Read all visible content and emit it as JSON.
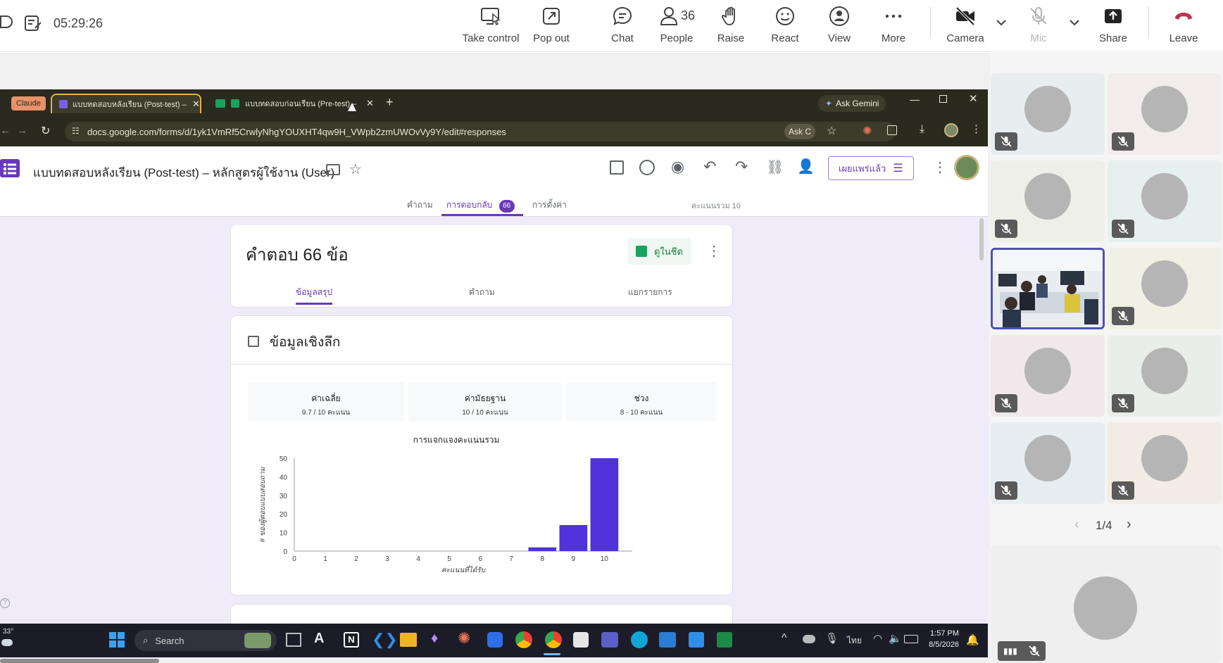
{
  "teams": {
    "timer": "05:29:26",
    "buttons": {
      "take_control": "Take control",
      "pop_out": "Pop out",
      "chat": "Chat",
      "people": "People",
      "people_count": "36",
      "raise": "Raise",
      "react": "React",
      "view": "View",
      "more": "More",
      "camera": "Camera",
      "mic": "Mic",
      "share": "Share",
      "leave": "Leave"
    },
    "pager": "1/4",
    "colors": {
      "leave": "#c4314b",
      "selected_tile": "#4f52b2"
    }
  },
  "chrome": {
    "profile_badge": "Claude",
    "tabs": [
      {
        "title": "แบบทดสอบหลังเรียน (Post-test) – ห"
      },
      {
        "title": "แบบทดสอบก่อนเรียน (Pre-test) – ห"
      }
    ],
    "ask_gemini": "Ask Gemini",
    "url": "docs.google.com/forms/d/1yk1VmRf5CrwlyNhgYOUXHT4qw9H_VWpb2zmUWOvVy9Y/edit#responses",
    "ask_chip": "Ask C"
  },
  "form": {
    "title": "แบบทดสอบหลังเรียน (Post-test) – หลักสูตรผู้ใช้งาน (User)",
    "tabs": {
      "questions": "คำถาม",
      "responses": "การตอบกลับ",
      "responses_count": "66",
      "settings": "การตั้งค่า"
    },
    "total_points": "คะแนนรวม 10",
    "publish_button": "เผยแพร่แล้ว",
    "responses_header": "คำตอบ 66 ข้อ",
    "sheets_link": "ดูในชีต",
    "subtabs": {
      "summary": "ข้อมูลสรุป",
      "question": "คำถาม",
      "individual": "แยกรายการ"
    },
    "insights_title": "ข้อมูลเชิงลึก",
    "stats": [
      {
        "label": "ค่าเฉลี่ย",
        "value": "9.7 / 10 คะแนน"
      },
      {
        "label": "ค่ามัธยฐาน",
        "value": "10 / 10 คะแนน"
      },
      {
        "label": "ช่วง",
        "value": "8 - 10 คะแนน"
      }
    ]
  },
  "chart_data": {
    "type": "bar",
    "title": "การแจกแจงคะแนนรวม",
    "xlabel": "คะแนนที่ได้รับ",
    "ylabel": "# ของผู้ตอบแบบสอบถาม",
    "categories": [
      "0",
      "1",
      "2",
      "3",
      "4",
      "5",
      "6",
      "7",
      "8",
      "9",
      "10"
    ],
    "values": [
      0,
      0,
      0,
      0,
      0,
      0,
      0,
      0,
      2,
      14,
      50
    ],
    "ylim": [
      0,
      50
    ],
    "yticks": [
      "0",
      "10",
      "20",
      "30",
      "40",
      "50"
    ],
    "bar_color": "#4f32db",
    "grid": false
  },
  "taskbar": {
    "temperature": "33°",
    "search": "Search",
    "lang": "ไทย",
    "time": "1:57 PM",
    "date": "8/5/2026"
  }
}
